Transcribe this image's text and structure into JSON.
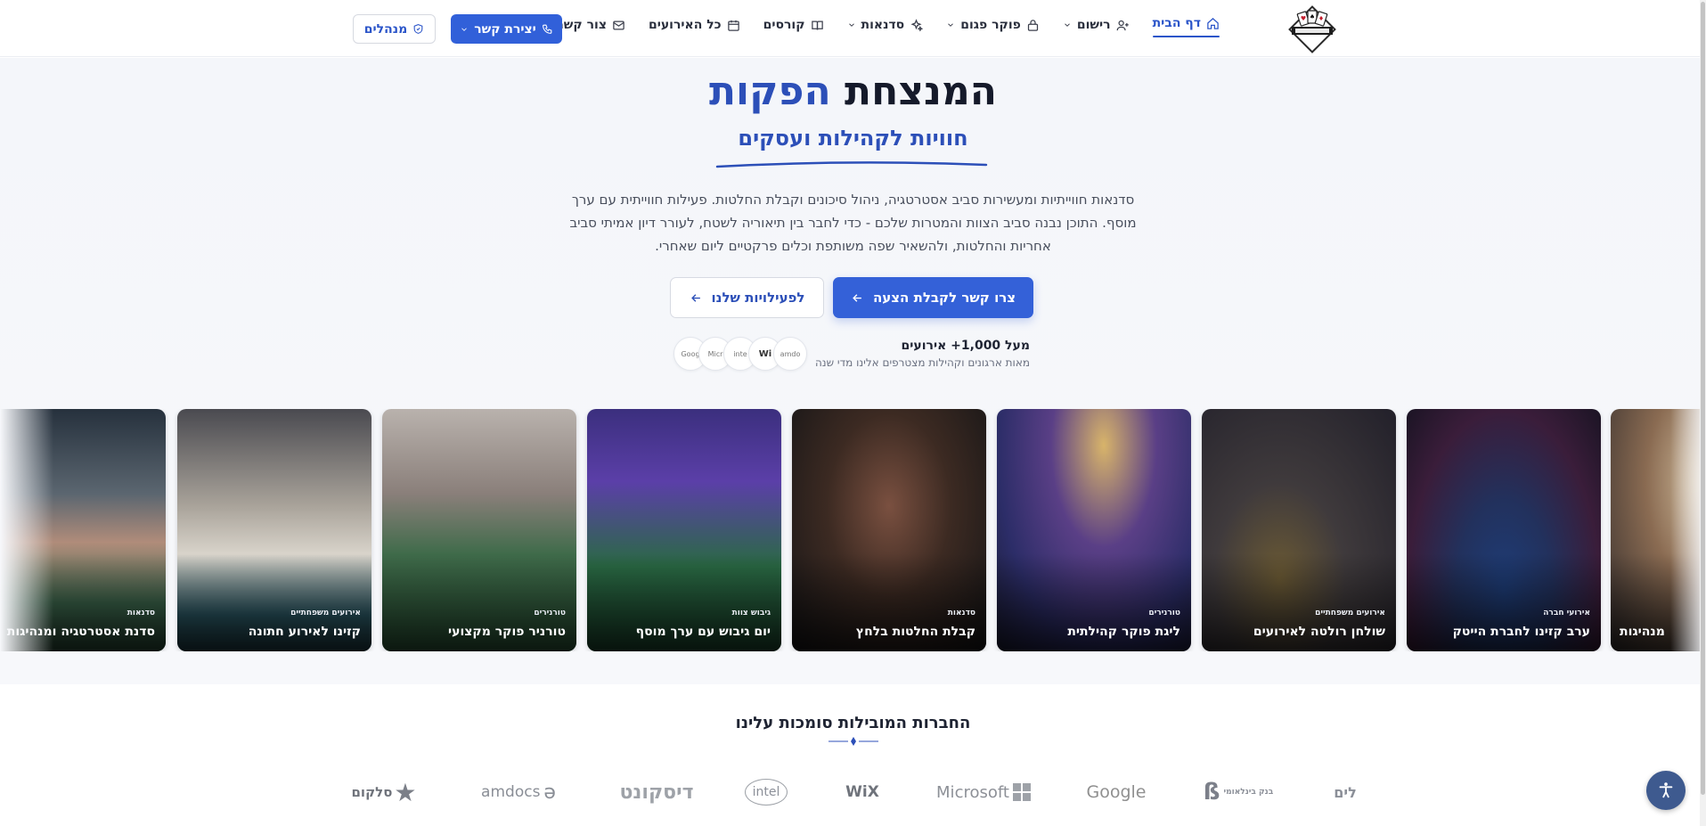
{
  "nav": {
    "items": [
      {
        "label": "דף הבית",
        "icon": "home-icon",
        "active": true
      },
      {
        "label": "רישום",
        "icon": "user-plus-icon",
        "dropdown": true
      },
      {
        "label": "פוקר פגום",
        "icon": "lock-icon",
        "dropdown": true
      },
      {
        "label": "סדנאות",
        "icon": "sparkle-icon",
        "dropdown": true
      },
      {
        "label": "קורסים",
        "icon": "book-icon"
      },
      {
        "label": "כל האירועים",
        "icon": "calendar-icon"
      },
      {
        "label": "צור קשר",
        "icon": "mail-icon"
      }
    ],
    "contact_button": "יצירת קשר",
    "admin_button": "מנהלים"
  },
  "hero": {
    "title_main": "המנצחת",
    "title_accent": "הפקות",
    "subtitle": "חוויות לקהילות ועסקים",
    "description": "סדנאות חווייתיות ומעשירות סביב אסטרטגיה, ניהול סיכונים וקבלת החלטות. פעילות חווייתית עם ערך מוסף. התוכן נבנה סביב הצוות והמטרות שלכם - כדי לחבר בין תיאוריה לשטח, לעורר דיון אמיתי סביב אחריות והחלטות, ולהשאיר שפה משותפת וכלים פרקטיים ליום שאחרי.",
    "primary_cta": "צרו קשר לקבלת הצעה",
    "secondary_cta": "לפעילויות שלנו"
  },
  "social_proof": {
    "title": "מעל 1,000+ אירועים",
    "subtitle": "מאות ארגונים וקהילות מצטרפים אלינו מדי שנה",
    "logos": [
      "Goog",
      "Micr",
      "inte",
      "Wi",
      "amdo"
    ]
  },
  "gallery": [
    {
      "tag": "",
      "title": "מנהיגות"
    },
    {
      "tag": "אירועי חברה",
      "title": "ערב קזינו לחברת הייטק"
    },
    {
      "tag": "אירועים משפחתיים",
      "title": "שולחן רולטה לאירועים"
    },
    {
      "tag": "טורנירים",
      "title": "ליגת פוקר קהילתית"
    },
    {
      "tag": "סדנאות",
      "title": "קבלת החלטות בלחץ"
    },
    {
      "tag": "גיבוש צוות",
      "title": "יום גיבוש עם ערך מוסף"
    },
    {
      "tag": "טורנירים",
      "title": "טורניר פוקר מקצועי"
    },
    {
      "tag": "אירועים משפחתיים",
      "title": "קזינו לאירוע חתונה"
    },
    {
      "tag": "סדנאות",
      "title": "סדנת אסטרטגיה ומנהיגות"
    }
  ],
  "trusted": {
    "title": "החברות המובילות סומכות עלינו",
    "partners": [
      "לים",
      "בנק בינלאומי",
      "Google",
      "Microsoft",
      "WiX",
      "intel",
      "דיסקונט",
      "amdocs",
      "סלקום"
    ]
  },
  "colors": {
    "brand_blue": "#3160d9",
    "accent_text": "#2c4fb8"
  }
}
